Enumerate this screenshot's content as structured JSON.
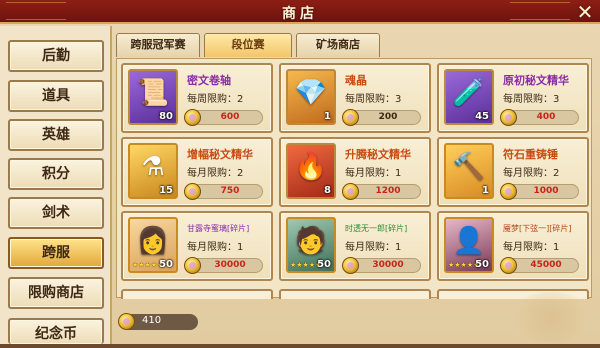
{
  "window": {
    "title": "商店",
    "close_glyph": "✕"
  },
  "sidebar": {
    "items": [
      {
        "label": "后勤",
        "active": false
      },
      {
        "label": "道具",
        "active": false
      },
      {
        "label": "英雄",
        "active": false
      },
      {
        "label": "积分",
        "active": false
      },
      {
        "label": "剑术",
        "active": false
      },
      {
        "label": "跨服",
        "active": true
      },
      {
        "label": "限购商店",
        "active": false
      },
      {
        "label": "纪念币",
        "active": false
      }
    ]
  },
  "tabs": [
    {
      "label": "跨服冠军赛",
      "active": false
    },
    {
      "label": "段位赛",
      "active": true
    },
    {
      "label": "矿场商店",
      "active": false
    }
  ],
  "shop": {
    "items": [
      {
        "name": "密文卷轴",
        "limit": "每周限购：2",
        "qty": "80",
        "price": "600",
        "icon": "scroll-icon",
        "glyph": "📜",
        "rarity": "purple",
        "name_color": "purple",
        "price_red": true
      },
      {
        "name": "魂晶",
        "limit": "每周限购：3",
        "qty": "1",
        "price": "200",
        "icon": "crystal-icon",
        "glyph": "💎",
        "rarity": "orange",
        "name_color": "orange",
        "price_red": false
      },
      {
        "name": "原初秘文精华",
        "limit": "每周限购：3",
        "qty": "45",
        "price": "400",
        "icon": "potion-icon",
        "glyph": "🧪",
        "rarity": "purple",
        "name_color": "purple",
        "price_red": true
      },
      {
        "name": "增幅秘文精华",
        "limit": "每月限购：2",
        "qty": "15",
        "price": "750",
        "icon": "flask-icon",
        "glyph": "⚗",
        "rarity": "gold",
        "name_color": "orange",
        "price_red": true
      },
      {
        "name": "升腾秘文精华",
        "limit": "每月限购：1",
        "qty": "8",
        "price": "1200",
        "icon": "elixir-icon",
        "glyph": "🔥",
        "rarity": "red",
        "name_color": "orange",
        "price_red": true
      },
      {
        "name": "符石重铸锤",
        "limit": "每月限购：2",
        "qty": "1",
        "price": "1000",
        "icon": "hammer-icon",
        "glyph": "🔨",
        "rarity": "gold",
        "name_color": "orange",
        "price_red": true
      },
      {
        "name": "甘露寺蜜璃[碎片]",
        "limit": "每月限购：1",
        "qty": "50",
        "price": "30000",
        "icon": "hero-portrait-icon",
        "glyph": "👩",
        "rarity": "gold",
        "name_color": "frag purple",
        "price_red": true,
        "stars": "★★★★★"
      },
      {
        "name": "时透无一郎[碎片]",
        "limit": "每月限购：1",
        "qty": "50",
        "price": "30000",
        "icon": "hero-portrait-icon",
        "glyph": "🧑",
        "rarity": "gold",
        "name_color": "frag green",
        "price_red": true,
        "stars": "★★★★★"
      },
      {
        "name": "魇梦[下弦一][碎片]",
        "limit": "每月限购：1",
        "qty": "50",
        "price": "45000",
        "icon": "hero-portrait-icon",
        "glyph": "👤",
        "rarity": "gold",
        "name_color": "frag orange",
        "price_red": true,
        "stars": "★★★★★"
      }
    ]
  },
  "currency": {
    "value": "410",
    "icon": "coin-icon"
  }
}
